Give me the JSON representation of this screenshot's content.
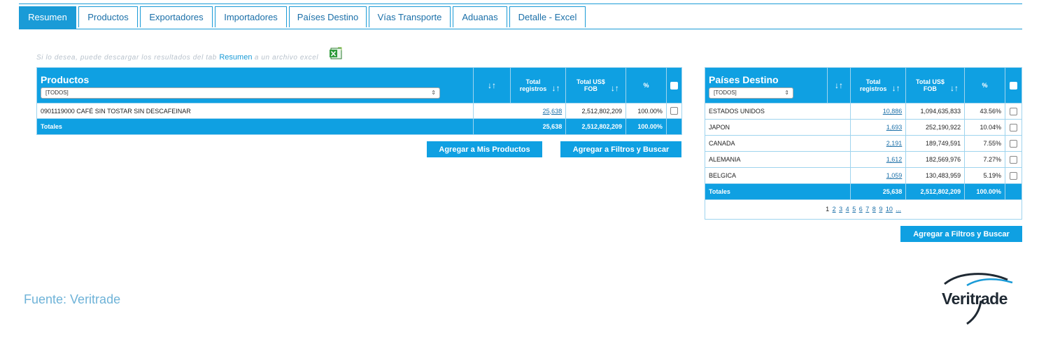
{
  "tabs": [
    {
      "label": "Resumen",
      "active": true
    },
    {
      "label": "Productos"
    },
    {
      "label": "Exportadores"
    },
    {
      "label": "Importadores"
    },
    {
      "label": "Países Destino"
    },
    {
      "label": "Vías Transporte"
    },
    {
      "label": "Aduanas"
    },
    {
      "label": "Detalle - Excel"
    }
  ],
  "note": {
    "prefix": "Si lo desea, puede descargar los resultados del tab",
    "link": "Resumen",
    "suffix": "a un archivo excel",
    "icon": "excel-icon"
  },
  "productos": {
    "title": "Productos",
    "filter": "[TODOS]",
    "sort_icon": "↓↑",
    "col_total": "Total registros",
    "col_fob": "Total US$ FOB",
    "col_pct": "%",
    "rows": [
      {
        "name": "0901119000 CAFÉ SIN TOSTAR SIN DESCAFEINAR",
        "total": "25,638",
        "fob": "2,512,802,209",
        "pct": "100.00%"
      }
    ],
    "totals": {
      "label": "Totales",
      "total": "25,638",
      "fob": "2,512,802,209",
      "pct": "100.00%"
    },
    "btn_mis_productos": "Agregar a Mis Productos",
    "btn_filtros": "Agregar a Filtros y Buscar"
  },
  "paises": {
    "title": "Países Destino",
    "filter": "[TODOS]",
    "sort_icon": "↓↑",
    "col_total": "Total registros",
    "col_fob": "Total US$ FOB",
    "col_pct": "%",
    "rows": [
      {
        "name": "ESTADOS UNIDOS",
        "total": "10,886",
        "fob": "1,094,635,833",
        "pct": "43.56%"
      },
      {
        "name": "JAPON",
        "total": "1,693",
        "fob": "252,190,922",
        "pct": "10.04%"
      },
      {
        "name": "CANADA",
        "total": "2,191",
        "fob": "189,749,591",
        "pct": "7.55%"
      },
      {
        "name": "ALEMANIA",
        "total": "1,612",
        "fob": "182,569,976",
        "pct": "7.27%"
      },
      {
        "name": "BELGICA",
        "total": "1,059",
        "fob": "130,483,959",
        "pct": "5.19%"
      }
    ],
    "totals": {
      "label": "Totales",
      "total": "25,638",
      "fob": "2,512,802,209",
      "pct": "100.00%"
    },
    "pages": [
      "1",
      "2",
      "3",
      "4",
      "5",
      "6",
      "7",
      "8",
      "9",
      "10",
      "..."
    ],
    "btn_filtros": "Agregar a Filtros y Buscar"
  },
  "footer": {
    "source": "Fuente: Veritrade",
    "logo": "Veritrade"
  },
  "colors": {
    "accent": "#0fa0e2",
    "link": "#1a6fa8",
    "border": "#9fd4ee"
  }
}
